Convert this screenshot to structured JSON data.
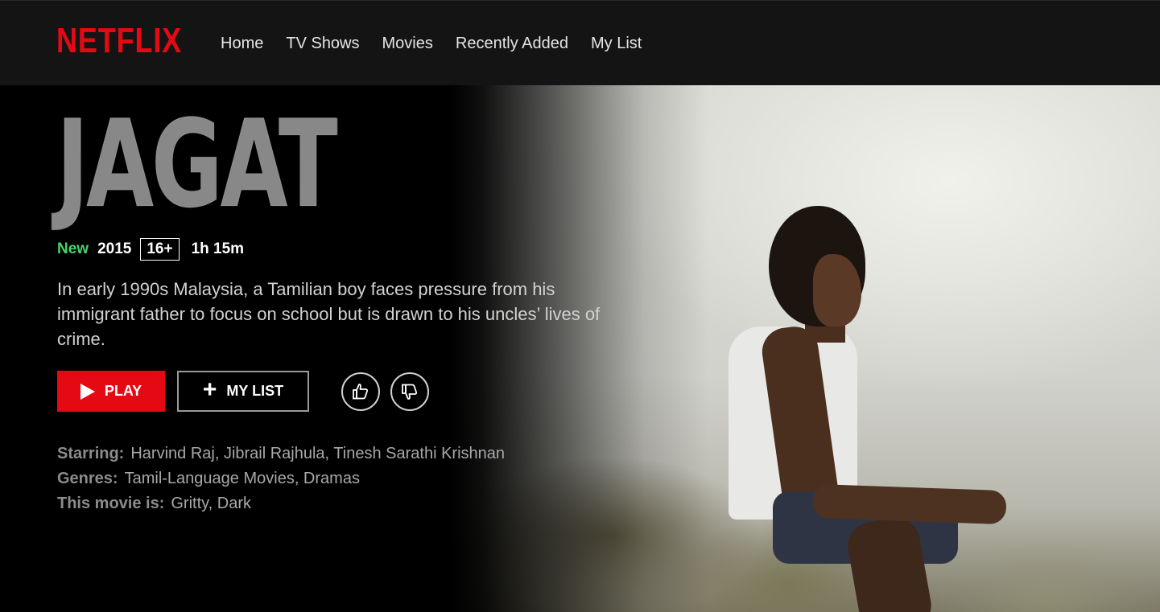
{
  "brand": {
    "logo_text": "NETFLIX",
    "accent": "#e50914"
  },
  "nav": {
    "items": [
      "Home",
      "TV Shows",
      "Movies",
      "Recently Added",
      "My List"
    ]
  },
  "title": {
    "art_text": "JAGAT"
  },
  "meta": {
    "badge_new": "New",
    "year": "2015",
    "maturity_rating": "16+",
    "duration": "1h 15m",
    "new_color": "#46d369"
  },
  "synopsis": "In early 1990s Malaysia, a Tamilian boy faces pressure from his immigrant father to focus on school but is drawn to his uncles’ lives of crime.",
  "actions": {
    "play_label": "PLAY",
    "mylist_label": "MY LIST",
    "play_icon": "play-icon",
    "mylist_icon": "plus-icon",
    "thumbs_up_icon": "thumbs-up-icon",
    "thumbs_down_icon": "thumbs-down-icon"
  },
  "details": {
    "starring_label": "Starring:",
    "starring_value": "Harvind Raj, Jibrail Rajhula, Tinesh Sarathi Krishnan",
    "genres_label": "Genres:",
    "genres_value": "Tamil-Language Movies, Dramas",
    "moviedesc_label": "This movie is:",
    "moviedesc_value": "Gritty, Dark"
  }
}
